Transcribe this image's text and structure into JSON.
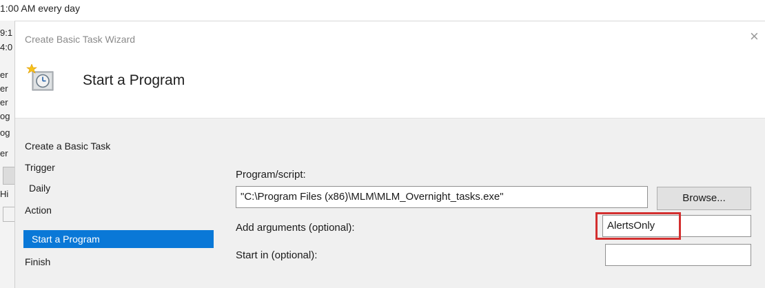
{
  "background_window": {
    "top_text": "1:00 AM every day",
    "fragments": [
      "9:1",
      "4:0",
      "er",
      "er",
      "er",
      "og",
      "og",
      "er",
      "Hi"
    ]
  },
  "wizard": {
    "window_title": "Create Basic Task Wizard",
    "close_glyph": "×",
    "page_title": "Start a Program",
    "header_icon": "task-clock-icon"
  },
  "steps": [
    {
      "label": "Create a Basic Task",
      "level": 0,
      "selected": false
    },
    {
      "label": "Trigger",
      "level": 0,
      "selected": false
    },
    {
      "label": "Daily",
      "level": 1,
      "selected": false
    },
    {
      "label": "Action",
      "level": 0,
      "selected": false
    },
    {
      "label": "Start a Program",
      "level": 1,
      "selected": true
    },
    {
      "label": "Finish",
      "level": 0,
      "selected": false
    }
  ],
  "form": {
    "program_label": "Program/script:",
    "program_value": "\"C:\\Program Files (x86)\\MLM\\MLM_Overnight_tasks.exe\"",
    "browse_label": "Browse...",
    "arguments_label": "Add arguments (optional):",
    "arguments_value": "AlertsOnly",
    "start_in_label": "Start in (optional):",
    "start_in_value": ""
  },
  "colors": {
    "selection": "#0a78d7",
    "highlight": "#d32f2f",
    "panel": "#f0f0f0"
  }
}
